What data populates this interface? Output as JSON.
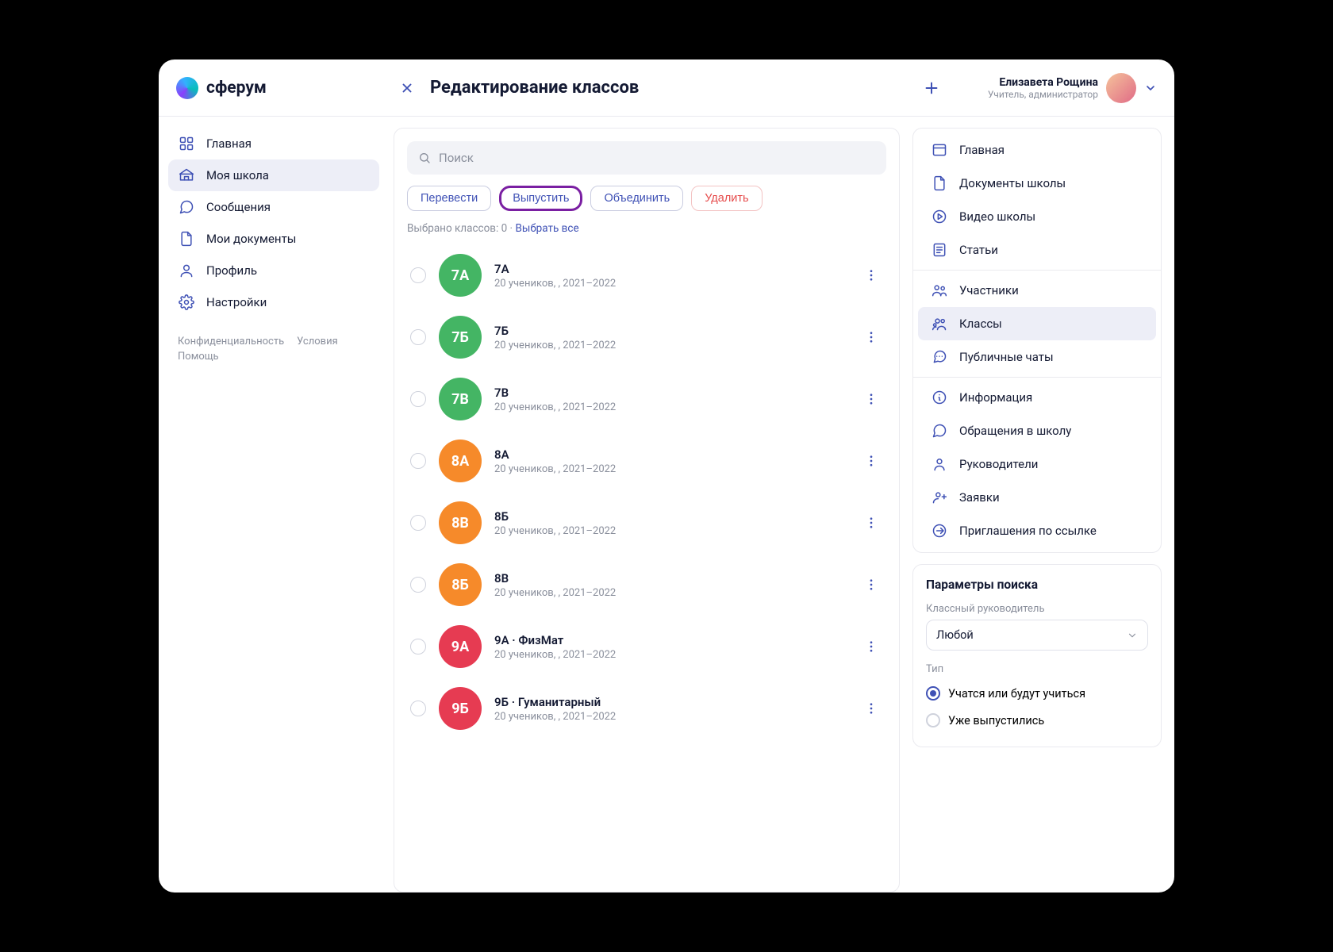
{
  "brand": {
    "name": "сферум"
  },
  "header": {
    "title": "Редактирование классов",
    "user_name": "Елизавета Рощина",
    "user_role": "Учитель, администратор"
  },
  "left_nav": {
    "items": [
      {
        "label": "Главная",
        "icon": "grid"
      },
      {
        "label": "Моя школа",
        "icon": "school",
        "active": true
      },
      {
        "label": "Сообщения",
        "icon": "message"
      },
      {
        "label": "Мои документы",
        "icon": "document"
      },
      {
        "label": "Профиль",
        "icon": "profile"
      },
      {
        "label": "Настройки",
        "icon": "gear"
      }
    ],
    "footer": [
      "Конфиденциальность",
      "Условия",
      "Помощь"
    ]
  },
  "center": {
    "search_placeholder": "Поиск",
    "actions": {
      "transfer": "Перевести",
      "graduate": "Выпустить",
      "merge": "Объединить",
      "delete": "Удалить"
    },
    "selection_prefix": "Выбрано классов: 0 · ",
    "select_all": "Выбрать все",
    "classes": [
      {
        "badge": "7А",
        "title": "7А",
        "sub": "20 учеников, , 2021–2022",
        "color": "#44b564"
      },
      {
        "badge": "7Б",
        "title": "7Б",
        "sub": "20 учеников, , 2021–2022",
        "color": "#44b564"
      },
      {
        "badge": "7В",
        "title": "7В",
        "sub": "20 учеников, , 2021–2022",
        "color": "#44b564"
      },
      {
        "badge": "8А",
        "title": "8А",
        "sub": "20 учеников, , 2021–2022",
        "color": "#f68a2a"
      },
      {
        "badge": "8В",
        "title": "8Б",
        "sub": "20 учеников, , 2021–2022",
        "color": "#f68a2a"
      },
      {
        "badge": "8Б",
        "title": "8В",
        "sub": "20 учеников, , 2021–2022",
        "color": "#f68a2a"
      },
      {
        "badge": "9А",
        "title": "9А · ФизМат",
        "sub": "20 учеников, , 2021–2022",
        "color": "#e63b52"
      },
      {
        "badge": "9Б",
        "title": "9Б · Гуманитарный",
        "sub": "20 учеников, , 2021–2022",
        "color": "#e63b52"
      }
    ]
  },
  "right_nav": {
    "group1": [
      {
        "label": "Главная",
        "icon": "window"
      },
      {
        "label": "Документы школы",
        "icon": "document"
      },
      {
        "label": "Видео школы",
        "icon": "play"
      },
      {
        "label": "Статьи",
        "icon": "article"
      }
    ],
    "group2": [
      {
        "label": "Участники",
        "icon": "people"
      },
      {
        "label": "Классы",
        "icon": "group",
        "active": true
      },
      {
        "label": "Публичные чаты",
        "icon": "chat"
      }
    ],
    "group3": [
      {
        "label": "Информация",
        "icon": "info"
      },
      {
        "label": "Обращения в школу",
        "icon": "message"
      },
      {
        "label": "Руководители",
        "icon": "person"
      },
      {
        "label": "Заявки",
        "icon": "requests"
      },
      {
        "label": "Приглашения по ссылке",
        "icon": "link"
      }
    ]
  },
  "params": {
    "title": "Параметры поиска",
    "teacher_label": "Классный руководитель",
    "teacher_value": "Любой",
    "type_label": "Тип",
    "type_options": [
      {
        "label": "Учатся или будут учиться",
        "checked": true
      },
      {
        "label": "Уже выпустились",
        "checked": false
      }
    ]
  }
}
